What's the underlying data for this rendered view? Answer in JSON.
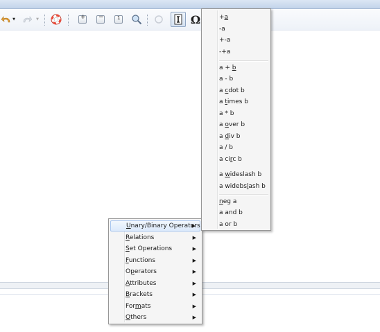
{
  "toolbar": {
    "icons": [
      "undo-icon",
      "redo-icon",
      "help-icon",
      "zoom-in-icon",
      "zoom-out-icon",
      "zoom-100-icon",
      "show-all-icon",
      "update-icon",
      "formula-cursor-icon",
      "symbols-icon"
    ],
    "symbols_glyph": "Ω"
  },
  "context_menu": {
    "items": [
      {
        "label": "Unary/Binary Operators",
        "highlighted": true
      },
      {
        "label": "Relations"
      },
      {
        "label": "Set Operations"
      },
      {
        "label": "Functions"
      },
      {
        "label": "Operators"
      },
      {
        "label": "Attributes"
      },
      {
        "label": "Brackets"
      },
      {
        "label": "Formats"
      },
      {
        "label": "Others"
      }
    ],
    "submenu_arrow": "▶"
  },
  "submenu": {
    "group1": [
      "+a",
      "-a",
      "+-a",
      "-+a"
    ],
    "group2": [
      "a + b",
      "a - b",
      "a cdot b",
      "a times b",
      "a * b",
      "a over b",
      "a div b",
      "a / b",
      "a circ b"
    ],
    "group3": [
      "a wideslash b",
      "a widebslash b"
    ],
    "group4": [
      "neg a",
      "a and b",
      "a or b"
    ]
  },
  "colors": {
    "menu_bg": "#f5f5f5",
    "highlight_border": "#a8c6ef",
    "titlebar": "#c3d4ea"
  }
}
